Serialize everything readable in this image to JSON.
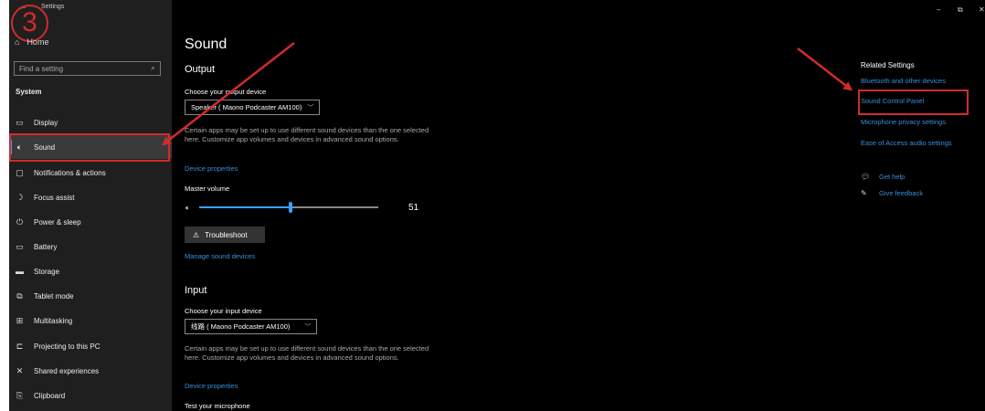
{
  "window": {
    "title": "Settings",
    "step_number": "3"
  },
  "sidebar": {
    "home_label": "Home",
    "search_placeholder": "Find a setting",
    "section_label": "System",
    "items": [
      {
        "label": "Display",
        "icon": "monitor-icon"
      },
      {
        "label": "Sound",
        "icon": "speaker-icon"
      },
      {
        "label": "Notifications & actions",
        "icon": "notification-icon"
      },
      {
        "label": "Focus assist",
        "icon": "moon-icon"
      },
      {
        "label": "Power & sleep",
        "icon": "power-icon"
      },
      {
        "label": "Battery",
        "icon": "battery-icon"
      },
      {
        "label": "Storage",
        "icon": "storage-icon"
      },
      {
        "label": "Tablet mode",
        "icon": "tablet-icon"
      },
      {
        "label": "Multitasking",
        "icon": "multitasking-icon"
      },
      {
        "label": "Projecting to this PC",
        "icon": "projector-icon"
      },
      {
        "label": "Shared experiences",
        "icon": "shared-icon"
      },
      {
        "label": "Clipboard",
        "icon": "clipboard-icon"
      }
    ]
  },
  "main": {
    "title": "Sound",
    "output": {
      "heading": "Output",
      "device_label": "Choose your output device",
      "device_value": "Speaker ( Maono Podcaster AM100)",
      "description": "Certain apps may be set up to use different sound devices than the one selected here. Customize app volumes and devices in advanced sound options.",
      "device_properties": "Device properties",
      "master_volume_label": "Master volume",
      "volume": 51,
      "volume_display": "51",
      "troubleshoot": "Troubleshoot",
      "manage_devices": "Manage sound devices"
    },
    "input": {
      "heading": "Input",
      "device_label": "Choose your input device",
      "device_value": "线路 ( Maono Podcaster AM100)",
      "description": "Certain apps may be set up to use different sound devices than the one selected here. Customize app volumes and devices in advanced sound options.",
      "device_properties": "Device properties",
      "test_label": "Test your microphone"
    }
  },
  "related": {
    "title": "Related Settings",
    "links": [
      "Bluetooth and other devices",
      "Sound Control Panel",
      "Microphone privacy settings",
      "Ease of Access audio settings"
    ],
    "get_help": "Get help",
    "give_feedback": "Give feedback"
  },
  "colors": {
    "accent": "#3aa0ff",
    "link": "#3a8fd8",
    "annotation": "#d12b2b",
    "background": "#000000",
    "sidebar": "#1f1f1f"
  }
}
